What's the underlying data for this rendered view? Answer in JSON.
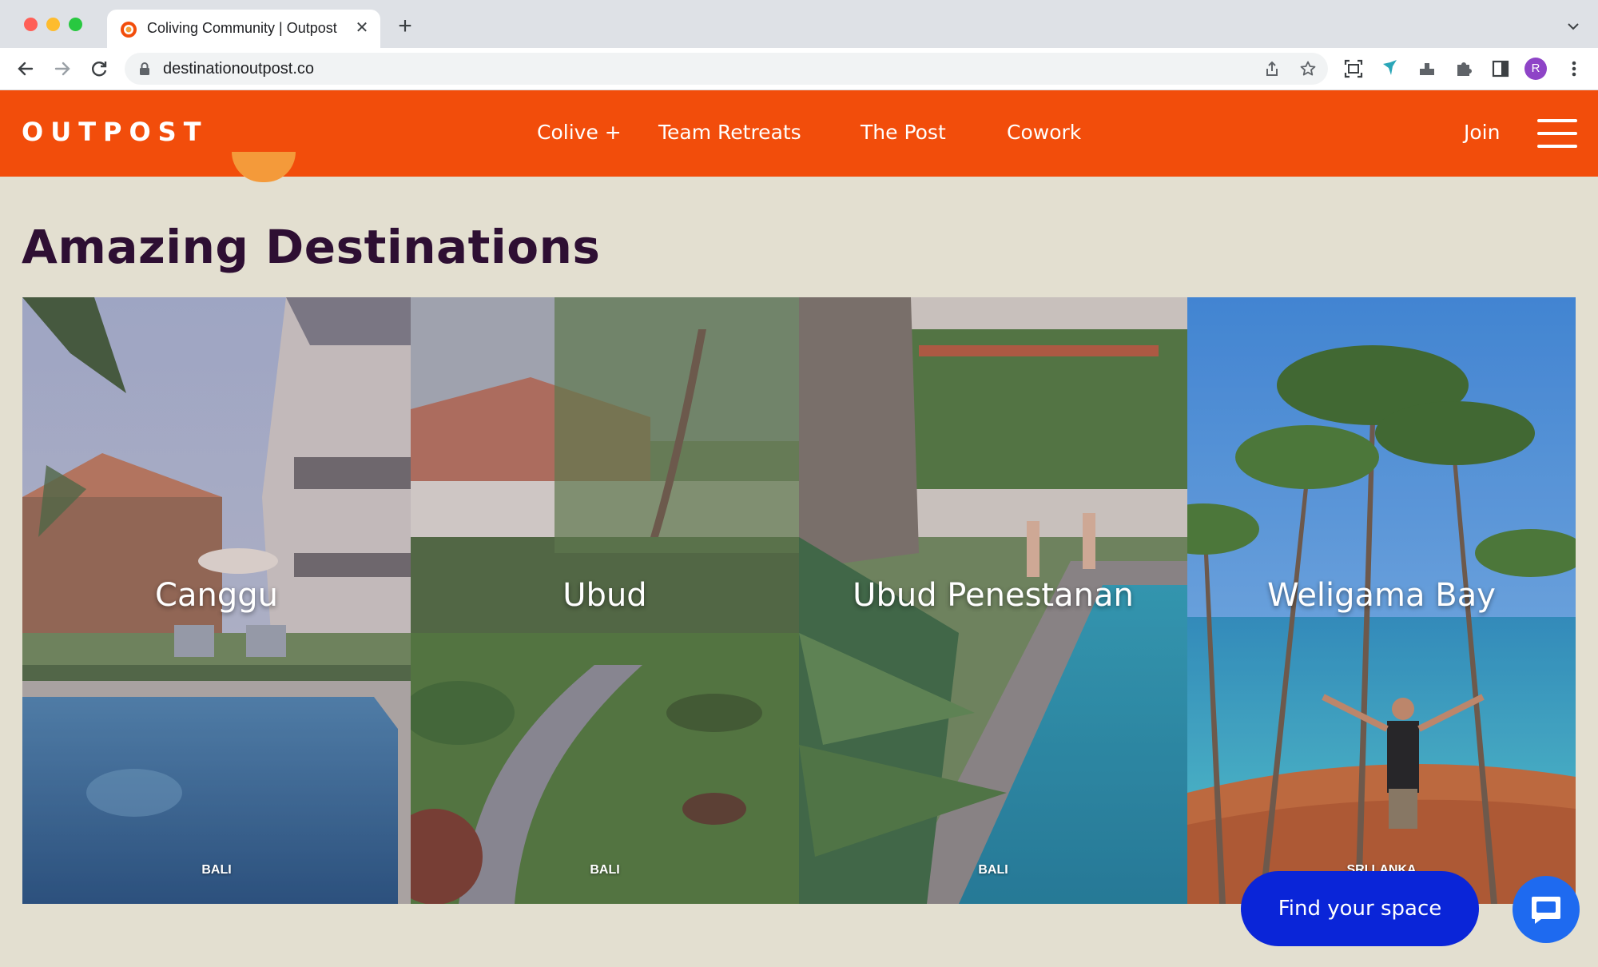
{
  "browser": {
    "tab_title": "Coliving Community | Outpost",
    "url": "destinationoutpost.co",
    "profile_initial": "R",
    "new_tab_glyph": "+",
    "close_glyph": "✕"
  },
  "header": {
    "logo": "OUTPOST",
    "nav": [
      "Colive +",
      "Team Retreats",
      "The Post",
      "Cowork"
    ],
    "join": "Join",
    "brand_color": "#f24d0b"
  },
  "section": {
    "title": "Amazing Destinations"
  },
  "destinations": [
    {
      "name": "Canggu",
      "country": "BALI"
    },
    {
      "name": "Ubud",
      "country": "BALI"
    },
    {
      "name": "Ubud Penestanan",
      "country": "BALI"
    },
    {
      "name": "Weligama Bay",
      "country": "SRI LANKA"
    }
  ],
  "cta": {
    "label": "Find your space",
    "color": "#0a25d8"
  },
  "icons": {
    "back": "arrow-left-icon",
    "forward": "arrow-right-icon",
    "reload": "reload-icon",
    "lock": "lock-icon",
    "share": "share-icon",
    "bookmark": "star-icon",
    "chat": "chat-icon",
    "menu": "hamburger-icon"
  }
}
